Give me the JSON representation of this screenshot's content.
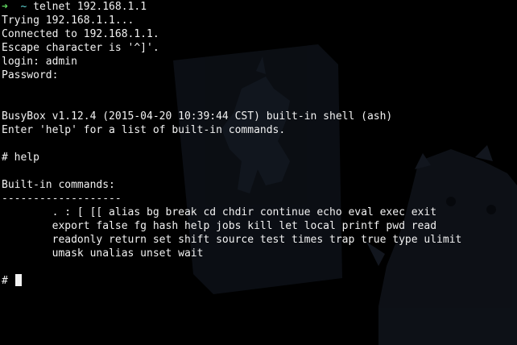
{
  "terminal": {
    "prompt_arrow": "➜",
    "prompt_dir": "~",
    "command": "telnet 192.168.1.1",
    "lines": {
      "trying": "Trying 192.168.1.1...",
      "connected": "Connected to 192.168.1.1.",
      "escape": "Escape character is '^]'.",
      "login": "login: admin",
      "password": "Password:",
      "banner": "BusyBox v1.12.4 (2015-04-20 10:39:44 CST) built-in shell (ash)",
      "enter_help": "Enter 'help' for a list of built-in commands.",
      "help_cmd": "# help",
      "builtin_header": "Built-in commands:",
      "separator": "-------------------",
      "cmds1": "        . : [ [[ alias bg break cd chdir continue echo eval exec exit",
      "cmds2": "        export false fg hash help jobs kill let local printf pwd read",
      "cmds3": "        readonly return set shift source test times trap true type ulimit",
      "cmds4": "        umask unalias unset wait",
      "final_prompt": "# "
    }
  },
  "colors": {
    "background": "#000000",
    "foreground": "#f2f2f2",
    "prompt_arrow": "#5fd75f",
    "prompt_dir": "#5fd7d7",
    "wallpaper_shapes": "#1d2430"
  },
  "wallpaper": {
    "icons": [
      "unicorn-poster-icon",
      "rhino-icon"
    ]
  }
}
